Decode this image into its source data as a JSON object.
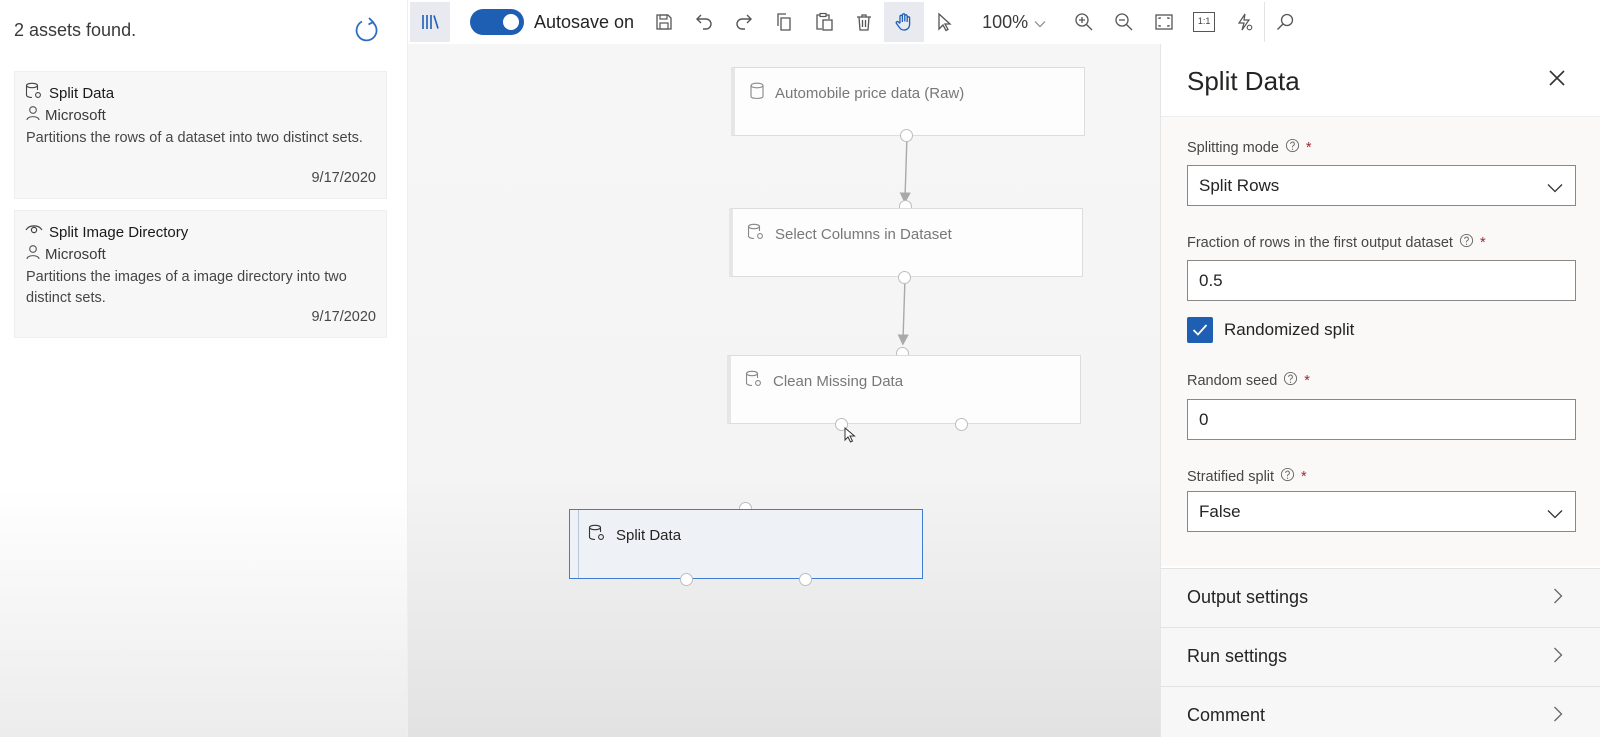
{
  "assets_panel": {
    "count_text": "2 assets found.",
    "assets": [
      {
        "name": "Split Data",
        "icon": "dataset-module-icon",
        "author": "Microsoft",
        "description": "Partitions the rows of a dataset into two distinct sets.",
        "date": "9/17/2020"
      },
      {
        "name": "Split Image Directory",
        "icon": "eye-icon",
        "author": "Microsoft",
        "description": "Partitions the images of a image directory into two distinct sets.",
        "date": "9/17/2020"
      }
    ]
  },
  "toolbar": {
    "autosave_label": "Autosave on",
    "autosave_on": true,
    "zoom": "100%",
    "fit_label": "1:1"
  },
  "canvas": {
    "nodes": [
      {
        "title": "Automobile price data (Raw)",
        "icon": "dataset-icon"
      },
      {
        "title": "Select Columns in Dataset",
        "icon": "module-icon"
      },
      {
        "title": "Clean Missing Data",
        "icon": "module-icon"
      },
      {
        "title": "Split Data",
        "icon": "module-icon",
        "selected": true
      }
    ]
  },
  "properties": {
    "title": "Split Data",
    "splitting_mode": {
      "label": "Splitting mode",
      "value": "Split Rows"
    },
    "fraction": {
      "label": "Fraction of rows in the first output dataset",
      "value": "0.5"
    },
    "randomized_split": {
      "label": "Randomized split",
      "checked": true
    },
    "random_seed": {
      "label": "Random seed",
      "value": "0"
    },
    "stratified_split": {
      "label": "Stratified split",
      "value": "False"
    },
    "required_marker": "*",
    "sections": [
      "Output settings",
      "Run settings",
      "Comment"
    ]
  },
  "colors": {
    "accent": "#1e5fb4",
    "selection_border": "#3d7ed4",
    "required": "#a4262c"
  }
}
